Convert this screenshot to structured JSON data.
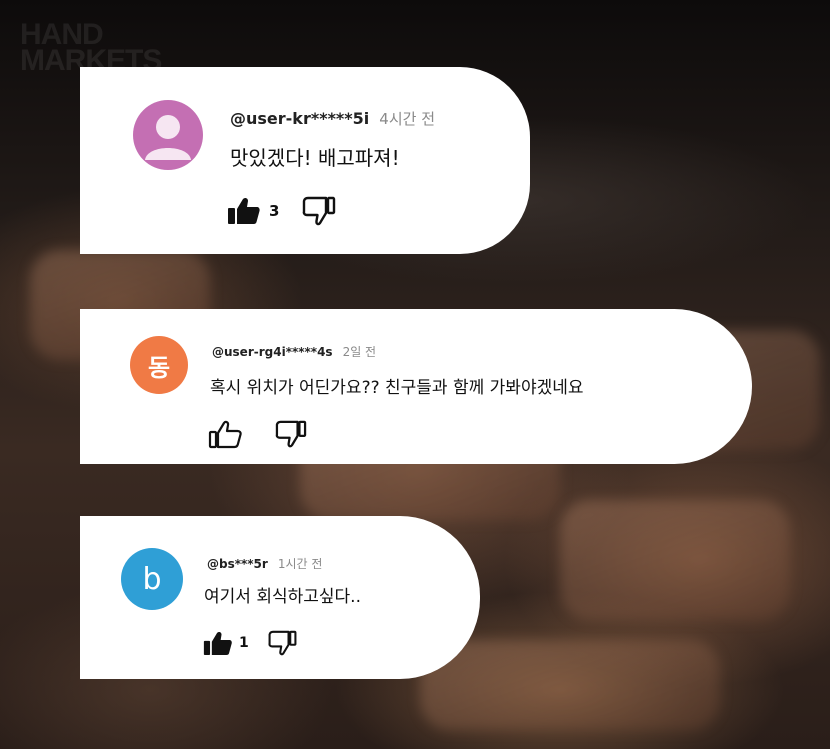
{
  "brand_watermark": [
    "HAND",
    "MARKETS"
  ],
  "comments": [
    {
      "handle": "@user-kr*****5i",
      "time": "4시간 전",
      "text": "맛있겠다! 배고파져!",
      "likes": "3",
      "avatar": {
        "type": "default-person-icon",
        "color": "#c46fb3"
      }
    },
    {
      "handle": "@user-rg4i*****4s",
      "time": "2일 전",
      "text": "혹시 위치가 어딘가요?? 친구들과 함께 가봐야겠네요",
      "likes": "",
      "avatar": {
        "type": "letter",
        "letter": "동",
        "color": "#f07a45"
      }
    },
    {
      "handle": "@bs***5r",
      "time": "1시간 전",
      "text": "여기서 회식하고싶다..",
      "likes": "1",
      "avatar": {
        "type": "letter",
        "letter": "b",
        "color": "#2f9fd6"
      }
    }
  ]
}
